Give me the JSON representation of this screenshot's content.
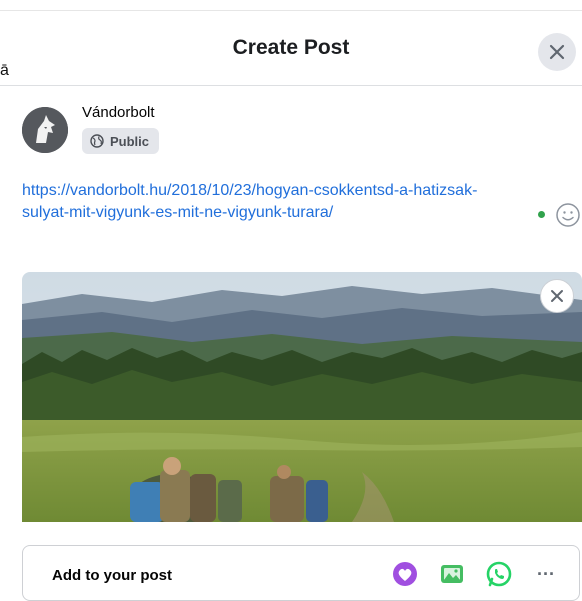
{
  "dialog": {
    "title": "Create Post",
    "stray_char": "ā"
  },
  "author": {
    "name": "Vándorbolt",
    "privacy": "Public"
  },
  "post": {
    "link_line1": "https://vandorbolt.hu/2018/10/23/hogyan-csokkentsd-a-hatizsak-",
    "link_line2": "sulyat-mit-vigyunk-es-mit-ne-vigyunk-turara/"
  },
  "composer": {
    "add_label": "Add to your post",
    "tools": [
      "feeling-icon",
      "photo-icon",
      "whatsapp-icon",
      "more-icon"
    ],
    "more_glyph": "···"
  },
  "icons": {
    "close": "close-icon",
    "globe": "globe-icon",
    "emoji": "emoji-icon",
    "preview_close": "close-icon"
  },
  "colors": {
    "link": "#216fdb",
    "online_dot": "#31a24c",
    "feeling": "#a04fe0",
    "photo": "#45bd62",
    "whatsapp": "#25d366"
  }
}
